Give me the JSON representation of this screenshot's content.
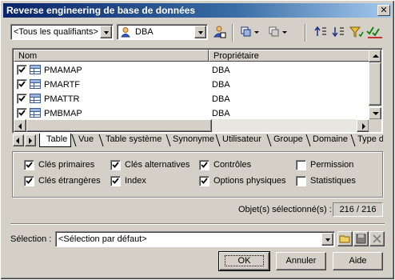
{
  "window": {
    "title": "Reverse engineering de base de données"
  },
  "toolbar": {
    "qualifier": "<Tous les qualifiants>",
    "owner": "DBA",
    "icons": [
      "user-select-icon",
      "select-all-icon",
      "deselect-all-icon",
      "move-up-icon",
      "move-down-icon",
      "filter-icon",
      "check-all-icon"
    ]
  },
  "table": {
    "columns": [
      "Nom",
      "Propriétaire"
    ],
    "rows": [
      {
        "name": "PMAMAP",
        "owner": "DBA",
        "checked": true
      },
      {
        "name": "PMARTF",
        "owner": "DBA",
        "checked": true
      },
      {
        "name": "PMATTR",
        "owner": "DBA",
        "checked": true
      },
      {
        "name": "PMBMAP",
        "owner": "DBA",
        "checked": true
      }
    ]
  },
  "tabs": [
    "Table",
    "Vue",
    "Table système",
    "Synonyme",
    "Utilisateur",
    "Groupe",
    "Domaine",
    "Type de"
  ],
  "active_tab": "Table",
  "options": {
    "cles_primaires": {
      "label": "Clés primaires",
      "checked": true
    },
    "cles_alternatives": {
      "label": "Clés alternatives",
      "checked": true
    },
    "controles": {
      "label": "Contrôles",
      "checked": true
    },
    "permission": {
      "label": "Permission",
      "checked": false
    },
    "cles_etrangeres": {
      "label": "Clés étrangères",
      "checked": true
    },
    "index": {
      "label": "Index",
      "checked": true
    },
    "options_physiques": {
      "label": "Options physiques",
      "checked": true
    },
    "statistiques": {
      "label": "Statistiques",
      "checked": false
    }
  },
  "selection_count": {
    "label": "Objet(s) sélectionné(s) :",
    "value": "216 / 216"
  },
  "selection": {
    "label": "Sélection :",
    "value": "<Sélection par défaut>"
  },
  "buttons": {
    "ok": "OK",
    "cancel": "Annuler",
    "help": "Aide"
  }
}
